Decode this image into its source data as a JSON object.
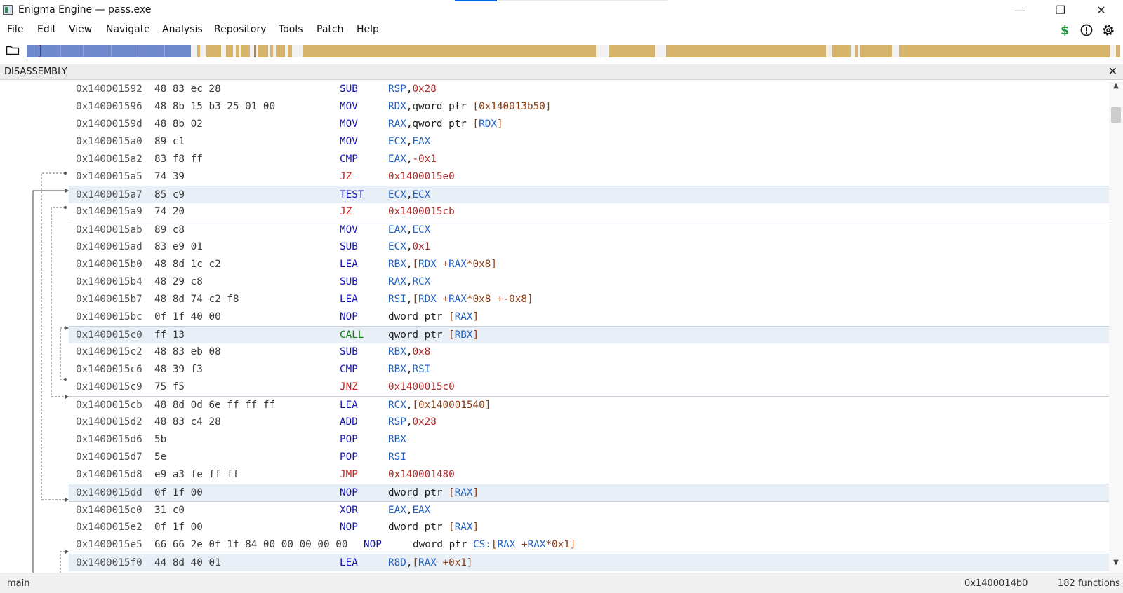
{
  "window": {
    "title": "Enigma Engine — pass.exe",
    "controls": {
      "minimize": "—",
      "restore": "❐",
      "close": "✕"
    }
  },
  "menu": [
    "File",
    "Edit",
    "View",
    "Navigate",
    "Analysis",
    "Repository",
    "Tools",
    "Patch",
    "Help"
  ],
  "toolbar_icons": [
    "dollar-icon",
    "alert-icon",
    "gear-icon"
  ],
  "colors": {
    "code_segment": "#6f88cc",
    "data_segment": "#d6b46c",
    "dollar": "#1e9a3c"
  },
  "panel": {
    "title": "DISASSEMBLY",
    "close": "✕"
  },
  "rows": [
    {
      "addr": "0x140001592",
      "bytes": "48 83 ec 28",
      "mn": "SUB",
      "mc": "mn-blue",
      "ops": [
        [
          "RSP",
          "o-reg"
        ],
        [
          ",",
          "o-txt"
        ],
        [
          "0x28",
          "o-num"
        ]
      ],
      "hl": false,
      "sep": false
    },
    {
      "addr": "0x140001596",
      "bytes": "48 8b 15 b3 25 01 00",
      "mn": "MOV",
      "mc": "mn-blue",
      "ops": [
        [
          "RDX",
          "o-reg"
        ],
        [
          ",qword ptr ",
          "o-txt"
        ],
        [
          "[0x140013b50]",
          "o-mem"
        ]
      ],
      "hl": false,
      "sep": false
    },
    {
      "addr": "0x14000159d",
      "bytes": "48 8b 02",
      "mn": "MOV",
      "mc": "mn-blue",
      "ops": [
        [
          "RAX",
          "o-reg"
        ],
        [
          ",qword ptr ",
          "o-txt"
        ],
        [
          "[",
          "o-mem"
        ],
        [
          "RDX",
          "o-reg"
        ],
        [
          "]",
          "o-mem"
        ]
      ],
      "hl": false,
      "sep": false
    },
    {
      "addr": "0x1400015a0",
      "bytes": "89 c1",
      "mn": "MOV",
      "mc": "mn-blue",
      "ops": [
        [
          "ECX",
          "o-reg"
        ],
        [
          ",",
          "o-txt"
        ],
        [
          "EAX",
          "o-reg"
        ]
      ],
      "hl": false,
      "sep": false
    },
    {
      "addr": "0x1400015a2",
      "bytes": "83 f8 ff",
      "mn": "CMP",
      "mc": "mn-blue",
      "ops": [
        [
          "EAX",
          "o-reg"
        ],
        [
          ",",
          "o-txt"
        ],
        [
          "-0x1",
          "o-num"
        ]
      ],
      "hl": false,
      "sep": false
    },
    {
      "addr": "0x1400015a5",
      "bytes": "74 39",
      "mn": "JZ",
      "mc": "mn-red",
      "ops": [
        [
          "0x1400015e0",
          "o-num"
        ]
      ],
      "hl": false,
      "sep": false
    },
    {
      "addr": "0x1400015a7",
      "bytes": "85 c9",
      "mn": "TEST",
      "mc": "mn-blue",
      "ops": [
        [
          "ECX",
          "o-reg"
        ],
        [
          ",",
          "o-txt"
        ],
        [
          "ECX",
          "o-reg"
        ]
      ],
      "hl": true,
      "sep": true
    },
    {
      "addr": "0x1400015a9",
      "bytes": "74 20",
      "mn": "JZ",
      "mc": "mn-red",
      "ops": [
        [
          "0x1400015cb",
          "o-num"
        ]
      ],
      "hl": false,
      "sep": false
    },
    {
      "addr": "0x1400015ab",
      "bytes": "89 c8",
      "mn": "MOV",
      "mc": "mn-blue",
      "ops": [
        [
          "EAX",
          "o-reg"
        ],
        [
          ",",
          "o-txt"
        ],
        [
          "ECX",
          "o-reg"
        ]
      ],
      "hl": false,
      "sep": true
    },
    {
      "addr": "0x1400015ad",
      "bytes": "83 e9 01",
      "mn": "SUB",
      "mc": "mn-blue",
      "ops": [
        [
          "ECX",
          "o-reg"
        ],
        [
          ",",
          "o-txt"
        ],
        [
          "0x1",
          "o-num"
        ]
      ],
      "hl": false,
      "sep": false
    },
    {
      "addr": "0x1400015b0",
      "bytes": "48 8d 1c c2",
      "mn": "LEA",
      "mc": "mn-blue",
      "ops": [
        [
          "RBX",
          "o-reg"
        ],
        [
          ",",
          "o-txt"
        ],
        [
          "[",
          "o-mem"
        ],
        [
          "RDX",
          "o-reg"
        ],
        [
          " +",
          "o-mem"
        ],
        [
          "RAX",
          "o-reg"
        ],
        [
          "*0x8]",
          "o-mem"
        ]
      ],
      "hl": false,
      "sep": false
    },
    {
      "addr": "0x1400015b4",
      "bytes": "48 29 c8",
      "mn": "SUB",
      "mc": "mn-blue",
      "ops": [
        [
          "RAX",
          "o-reg"
        ],
        [
          ",",
          "o-txt"
        ],
        [
          "RCX",
          "o-reg"
        ]
      ],
      "hl": false,
      "sep": false
    },
    {
      "addr": "0x1400015b7",
      "bytes": "48 8d 74 c2 f8",
      "mn": "LEA",
      "mc": "mn-blue",
      "ops": [
        [
          "RSI",
          "o-reg"
        ],
        [
          ",",
          "o-txt"
        ],
        [
          "[",
          "o-mem"
        ],
        [
          "RDX",
          "o-reg"
        ],
        [
          " +",
          "o-mem"
        ],
        [
          "RAX",
          "o-reg"
        ],
        [
          "*0x8 +-0x8]",
          "o-mem"
        ]
      ],
      "hl": false,
      "sep": false
    },
    {
      "addr": "0x1400015bc",
      "bytes": "0f 1f 40 00",
      "mn": "NOP",
      "mc": "mn-blue",
      "ops": [
        [
          "dword ptr ",
          "o-txt"
        ],
        [
          "[",
          "o-mem"
        ],
        [
          "RAX",
          "o-reg"
        ],
        [
          "]",
          "o-mem"
        ]
      ],
      "hl": false,
      "sep": false
    },
    {
      "addr": "0x1400015c0",
      "bytes": "ff 13",
      "mn": "CALL",
      "mc": "mn-green",
      "ops": [
        [
          "qword ptr ",
          "o-txt"
        ],
        [
          "[",
          "o-mem"
        ],
        [
          "RBX",
          "o-reg"
        ],
        [
          "]",
          "o-mem"
        ]
      ],
      "hl": true,
      "sep": true
    },
    {
      "addr": "0x1400015c2",
      "bytes": "48 83 eb 08",
      "mn": "SUB",
      "mc": "mn-blue",
      "ops": [
        [
          "RBX",
          "o-reg"
        ],
        [
          ",",
          "o-txt"
        ],
        [
          "0x8",
          "o-num"
        ]
      ],
      "hl": false,
      "sep": false
    },
    {
      "addr": "0x1400015c6",
      "bytes": "48 39 f3",
      "mn": "CMP",
      "mc": "mn-blue",
      "ops": [
        [
          "RBX",
          "o-reg"
        ],
        [
          ",",
          "o-txt"
        ],
        [
          "RSI",
          "o-reg"
        ]
      ],
      "hl": false,
      "sep": false
    },
    {
      "addr": "0x1400015c9",
      "bytes": "75 f5",
      "mn": "JNZ",
      "mc": "mn-red",
      "ops": [
        [
          "0x1400015c0",
          "o-num"
        ]
      ],
      "hl": false,
      "sep": false
    },
    {
      "addr": "0x1400015cb",
      "bytes": "48 8d 0d 6e ff ff ff",
      "mn": "LEA",
      "mc": "mn-blue",
      "ops": [
        [
          "RCX",
          "o-reg"
        ],
        [
          ",",
          "o-txt"
        ],
        [
          "[0x140001540]",
          "o-mem"
        ]
      ],
      "hl": false,
      "sep": true
    },
    {
      "addr": "0x1400015d2",
      "bytes": "48 83 c4 28",
      "mn": "ADD",
      "mc": "mn-blue",
      "ops": [
        [
          "RSP",
          "o-reg"
        ],
        [
          ",",
          "o-txt"
        ],
        [
          "0x28",
          "o-num"
        ]
      ],
      "hl": false,
      "sep": false
    },
    {
      "addr": "0x1400015d6",
      "bytes": "5b",
      "mn": "POP",
      "mc": "mn-blue",
      "ops": [
        [
          "RBX",
          "o-reg"
        ]
      ],
      "hl": false,
      "sep": false
    },
    {
      "addr": "0x1400015d7",
      "bytes": "5e",
      "mn": "POP",
      "mc": "mn-blue",
      "ops": [
        [
          "RSI",
          "o-reg"
        ]
      ],
      "hl": false,
      "sep": false
    },
    {
      "addr": "0x1400015d8",
      "bytes": "e9 a3 fe ff ff",
      "mn": "JMP",
      "mc": "mn-red",
      "ops": [
        [
          "0x140001480",
          "o-num"
        ]
      ],
      "hl": false,
      "sep": false
    },
    {
      "addr": "0x1400015dd",
      "bytes": "0f 1f 00",
      "mn": "NOP",
      "mc": "mn-blue",
      "ops": [
        [
          "dword ptr ",
          "o-txt"
        ],
        [
          "[",
          "o-mem"
        ],
        [
          "RAX",
          "o-reg"
        ],
        [
          "]",
          "o-mem"
        ]
      ],
      "hl": true,
      "sep": true
    },
    {
      "addr": "0x1400015e0",
      "bytes": "31 c0",
      "mn": "XOR",
      "mc": "mn-blue",
      "ops": [
        [
          "EAX",
          "o-reg"
        ],
        [
          ",",
          "o-txt"
        ],
        [
          "EAX",
          "o-reg"
        ]
      ],
      "hl": false,
      "sep": true
    },
    {
      "addr": "0x1400015e2",
      "bytes": "0f 1f 00",
      "mn": "NOP",
      "mc": "mn-blue",
      "ops": [
        [
          "dword ptr ",
          "o-txt"
        ],
        [
          "[",
          "o-mem"
        ],
        [
          "RAX",
          "o-reg"
        ],
        [
          "]",
          "o-mem"
        ]
      ],
      "hl": false,
      "sep": false
    },
    {
      "addr": "0x1400015e5",
      "bytes": "66 66 2e 0f 1f 84 00 00 00 00 00",
      "mn": "NOP",
      "mc": "mn-blue",
      "wide": true,
      "ops": [
        [
          "dword ptr ",
          "o-txt"
        ],
        [
          "CS:",
          "o-reg"
        ],
        [
          "[",
          "o-mem"
        ],
        [
          "RAX",
          "o-reg"
        ],
        [
          " +",
          "o-mem"
        ],
        [
          "RAX",
          "o-reg"
        ],
        [
          "*0x1]",
          "o-mem"
        ]
      ],
      "hl": false,
      "sep": false
    },
    {
      "addr": "0x1400015f0",
      "bytes": "44 8d 40 01",
      "mn": "LEA",
      "mc": "mn-blue",
      "ops": [
        [
          "R8D",
          "o-reg"
        ],
        [
          ",",
          "o-txt"
        ],
        [
          "[",
          "o-mem"
        ],
        [
          "RAX",
          "o-reg"
        ],
        [
          " +0x1]",
          "o-mem"
        ]
      ],
      "hl": true,
      "sep": true
    }
  ],
  "status": {
    "function": "main",
    "address": "0x1400014b0",
    "function_count": "182 functions"
  }
}
